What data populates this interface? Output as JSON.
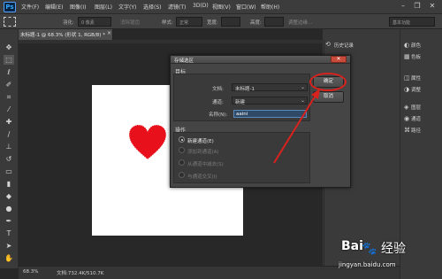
{
  "app": {
    "logo": "Ps"
  },
  "menubar": {
    "items": [
      "文件(F)",
      "编辑(E)",
      "图像(I)",
      "图层(L)",
      "文字(Y)",
      "选择(S)",
      "滤镜(T)",
      "3D(D)",
      "视图(V)",
      "窗口(W)",
      "帮助(H)"
    ],
    "window_controls": {
      "minimize": "–",
      "restore": "❐",
      "close": "✕"
    }
  },
  "options_bar": {
    "feather_label": "羽化:",
    "feather_value": "0 像素",
    "antialias_label": "消除锯齿",
    "style_label": "样式:",
    "style_value": "正常",
    "width_label": "宽度:",
    "height_label": "高度:",
    "refine_label": "调整边缘...",
    "workspace_value": "基本功能"
  },
  "document": {
    "tab_label": "未标题-1 @ 68.3% (形状 1, RGB/8) *",
    "close_glyph": "×",
    "heart_color": "#e8111b"
  },
  "status": {
    "zoom": "68.3%",
    "doc_size": "文档:732.4K/510.7K"
  },
  "history_panel": {
    "label": "历史记录"
  },
  "right_panels": [
    {
      "icon": "color-icon",
      "label": "颜色"
    },
    {
      "icon": "swatches-icon",
      "label": "色板"
    },
    {
      "icon": "adjust-icon",
      "label": "属性"
    },
    {
      "icon": "adjust2-icon",
      "label": "调整"
    },
    {
      "icon": "layers-icon",
      "label": "图层"
    },
    {
      "icon": "channels-icon",
      "label": "通道"
    },
    {
      "icon": "paths-icon",
      "label": "路径"
    }
  ],
  "dialog": {
    "title": "存储选区",
    "close_glyph": "✕",
    "destination_label": "目标",
    "doc_label": "文档:",
    "doc_value": "未标题-1",
    "channel_label": "通道:",
    "channel_value": "新建",
    "name_label": "名称(N):",
    "name_value": "aaini",
    "operation_label": "操作",
    "options": [
      {
        "label": "新建通道(E)",
        "selected": true
      },
      {
        "label": "添加到通道(A)",
        "selected": false
      },
      {
        "label": "从通道中减去(S)",
        "selected": false
      },
      {
        "label": "与通道交叉(I)",
        "selected": false
      }
    ],
    "ok_label": "确定",
    "cancel_label": "取消",
    "annotation_color": "#d9221d"
  },
  "watermark": {
    "brand_left": "Bai",
    "brand_right": "经验",
    "url": "jingyan.baidu.com"
  }
}
